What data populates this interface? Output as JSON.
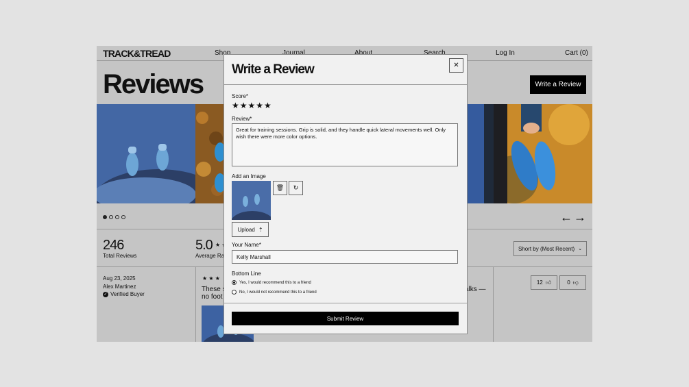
{
  "header": {
    "logo": "TRACK&TREAD",
    "nav": [
      "Shop",
      "Journal",
      "About",
      "Search"
    ],
    "login": "Log In",
    "cart": "Cart (0)"
  },
  "hero": {
    "title": "Reviews",
    "write_button": "Write a Review"
  },
  "carousel": {
    "dot_count": 4,
    "active_index": 0
  },
  "summary": {
    "total_reviews_value": "246",
    "total_reviews_label": "Total Reviews",
    "avg_rating_value": "5.0",
    "avg_rating_label": "Average Rat",
    "sort_label": "Short by (Most Recent)"
  },
  "review": {
    "date": "Aug 23, 2025",
    "author": "Alex Martinez",
    "badge": "Verified Buyer",
    "text_start": "These s",
    "text_start_line2": "no foot",
    "text_end": "alks —",
    "helpful_count": "12",
    "unhelpful_count": "0"
  },
  "modal": {
    "title": "Write a Review",
    "score_label": "Score*",
    "score_stars": "★★★★★",
    "score_value": 5,
    "review_label": "Review*",
    "review_text": "Great for training sessions. Grip is solid, and they handle quick lateral movements well. Only wish there were more color options.",
    "image_label": "Add an Image",
    "upload_label": "Upload",
    "name_label": "Your Name*",
    "name_value": "Kelly Marshall",
    "bottom_line_label": "Bottom Line",
    "recommend_yes": "Yes, I would recommend this to a friend",
    "recommend_no": "No, I would not recommend this to a friend",
    "recommend_selected": "yes",
    "submit_label": "Submit Review"
  },
  "icons": {
    "close": "close-icon",
    "delete": "trash-icon",
    "replace": "refresh-icon",
    "upload": "upload-icon",
    "thumbs_up": "thumbs-up-icon",
    "thumbs_down": "thumbs-down-icon",
    "verified": "check-circle-icon"
  }
}
